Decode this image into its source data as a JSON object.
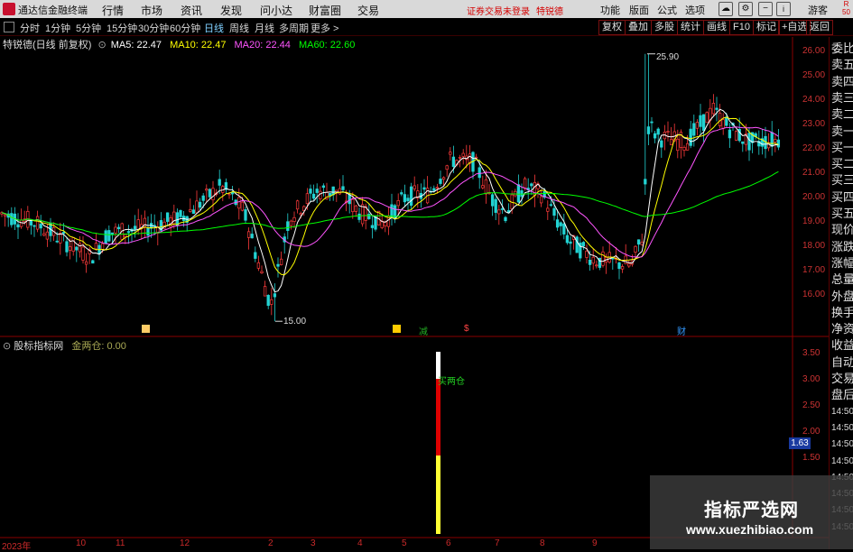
{
  "app": {
    "name": "通达信金融终端",
    "menus": [
      "行情",
      "市场",
      "资讯",
      "发现",
      "问小达",
      "财富圈",
      "交易"
    ],
    "notice": "证券交易未登录",
    "stock_short": "特锐德",
    "right_menus": [
      "功能",
      "版面",
      "公式",
      "选项"
    ],
    "guest": "游客",
    "right_tag": "R 50"
  },
  "periods": [
    "分时",
    "1分钟",
    "5分钟",
    "15分钟",
    "30分钟",
    "60分钟",
    "日线",
    "周线",
    "月线",
    "多周期",
    "更多 >"
  ],
  "toolbar_right": [
    "复权",
    "叠加",
    "多股",
    "统计",
    "画线",
    "F10",
    "标记",
    "+自选",
    "返回"
  ],
  "main_chart": {
    "title": "特锐德(日线 前复权)",
    "ma": [
      {
        "label": "MA5: 22.47",
        "color": "#ffffff"
      },
      {
        "label": "MA10: 22.47",
        "color": "#ffff00"
      },
      {
        "label": "MA20: 22.44",
        "color": "#ff55ff"
      },
      {
        "label": "MA60: 22.60",
        "color": "#00ff00"
      }
    ],
    "high_label": "25.90",
    "low_label": "15.00",
    "y_ticks": [
      "26.00",
      "25.00",
      "24.00",
      "23.00",
      "22.00",
      "21.00",
      "20.00",
      "19.00",
      "18.00",
      "17.00",
      "16.00"
    ],
    "markers": [
      {
        "text": "",
        "color": "#ffcc66"
      },
      {
        "text": "",
        "color": "#ffcc00"
      },
      {
        "text": "减",
        "color": "#22aa22"
      },
      {
        "text": "$",
        "color": "#ff4444"
      },
      {
        "text": "财",
        "color": "#3399ff"
      }
    ]
  },
  "sub_chart": {
    "title": "股标指标网",
    "value_label": "金两仓: 0.00",
    "signal_label": "买两仓",
    "y_ticks": [
      "3.50",
      "3.00",
      "2.50",
      "2.00",
      "1.50"
    ],
    "current_value": "1.63"
  },
  "x_axis": [
    "2023年",
    "10",
    "11",
    "12",
    "2",
    "3",
    "4",
    "5",
    "6",
    "7",
    "8",
    "9"
  ],
  "right_panel": [
    "委比",
    "卖五",
    "卖四",
    "卖三",
    "卖二",
    "卖一",
    "买一",
    "买二",
    "买三",
    "买四",
    "买五",
    "现价",
    "涨跌",
    "涨幅",
    "总量",
    "外盘",
    "换手",
    "净资",
    "收益",
    "自动",
    "交易",
    "盘后",
    "14:50",
    "14:50",
    "14:50",
    "14:50",
    "14:50",
    "14:50",
    "14:50",
    "14:50"
  ],
  "watermark": {
    "cn": "指标严选网",
    "en": "www.xuezhibiao.com"
  }
}
